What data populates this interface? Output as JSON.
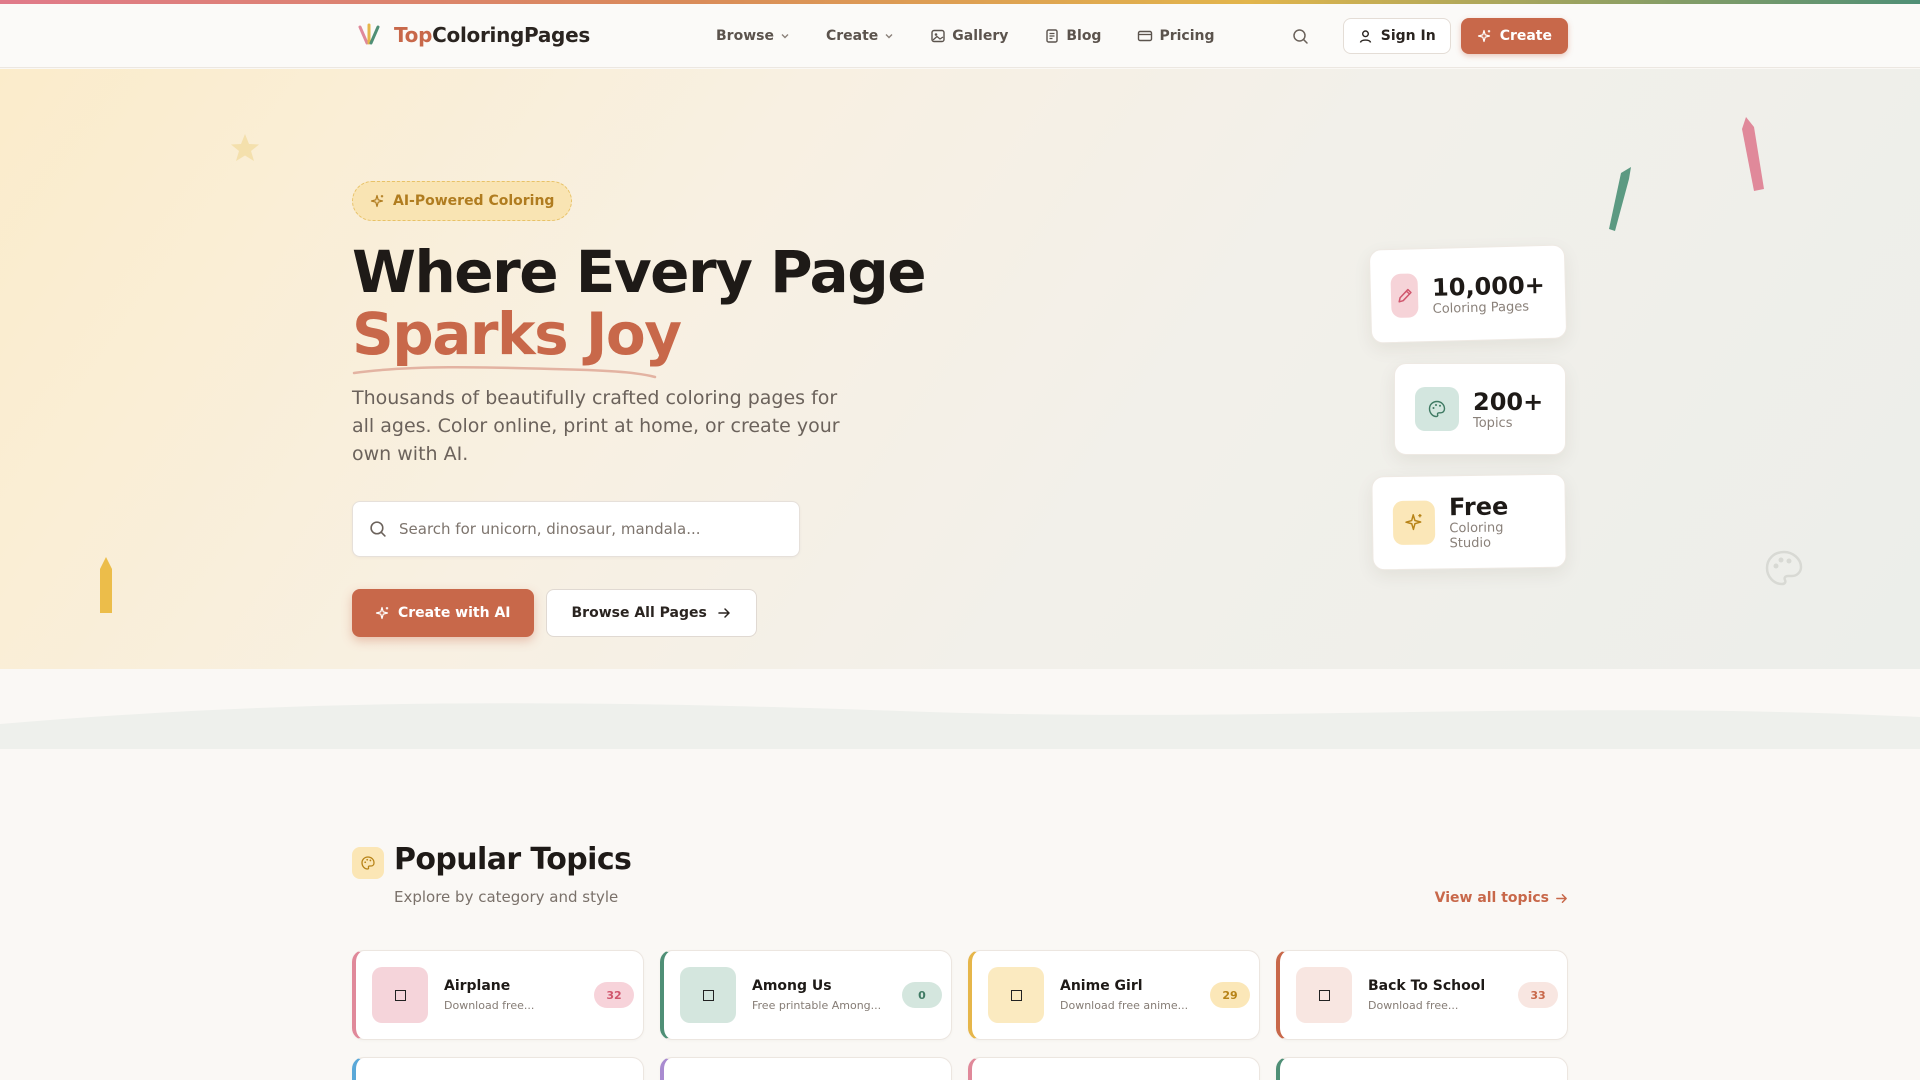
{
  "brand": {
    "prefix": "Top",
    "suffix": "ColoringPages"
  },
  "nav": [
    {
      "label": "Browse",
      "icon": "chevron-down-icon"
    },
    {
      "label": "Create",
      "icon": "chevron-down-icon"
    },
    {
      "label": "Gallery",
      "icon": "image-icon"
    },
    {
      "label": "Blog",
      "icon": "newspaper-icon"
    },
    {
      "label": "Pricing",
      "icon": "credit-card-icon"
    }
  ],
  "header": {
    "sign_in": "Sign In",
    "create": "Create"
  },
  "hero": {
    "badge": "AI-Powered Coloring",
    "title_line1": "Where Every Page",
    "title_line2": "Sparks Joy",
    "subtitle": "Thousands of beautifully crafted coloring pages for all ages. Color online, print at home, or create your own with AI.",
    "search_placeholder": "Search for unicorn, dinosaur, mandala...",
    "cta_primary": "Create with AI",
    "cta_secondary": "Browse All Pages"
  },
  "stats": [
    {
      "value": "10,000+",
      "label": "Coloring Pages",
      "icon": "pencil-icon",
      "color": "#f6d3d8"
    },
    {
      "value": "200+",
      "label": "Topics",
      "icon": "palette-icon",
      "color": "#d3e6df"
    },
    {
      "value": "Free",
      "label": "Coloring Studio",
      "icon": "sparkles-icon",
      "color": "#fbe7b8"
    }
  ],
  "popular": {
    "title": "Popular Topics",
    "subtitle": "Explore by category and style",
    "view_all": "View all topics"
  },
  "topics": [
    {
      "name": "Airplane",
      "desc": "Download free...",
      "count": "32",
      "accent": "#e0899a",
      "thumb": "#f5d4da",
      "count_bg": "#f7d3da",
      "count_fg": "#d0566d"
    },
    {
      "name": "Among Us",
      "desc": "Free printable Among...",
      "count": "0",
      "accent": "#4f8f76",
      "thumb": "#d4e6de",
      "count_bg": "#d4e6de",
      "count_fg": "#3f7a63"
    },
    {
      "name": "Anime Girl",
      "desc": "Download free anime...",
      "count": "29",
      "accent": "#e6b64a",
      "thumb": "#fbeac0",
      "count_bg": "#fbe7b8",
      "count_fg": "#b78317"
    },
    {
      "name": "Back To School",
      "desc": "Download free...",
      "count": "33",
      "accent": "#c8684a",
      "thumb": "#f8e6e1",
      "count_bg": "#f8e6e1",
      "count_fg": "#c8684a"
    }
  ],
  "partial_row_accents": [
    "#5aa8d8",
    "#a98bd0",
    "#e0899a",
    "#4f8f76"
  ]
}
